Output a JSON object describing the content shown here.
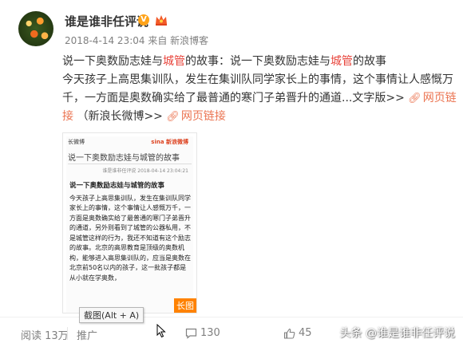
{
  "author": {
    "name": "谁是谁非任评说",
    "verified_badge": "V",
    "crown_icon": "crown-icon",
    "avatar_icon": "avatar-flowers"
  },
  "meta": {
    "timestamp": "2018-4-14 23:04",
    "source": "来自 新浪博客"
  },
  "post": {
    "title_a": "说一下奥数励志娃与",
    "title_hl1": "城管",
    "title_b": "的故事：说一下奥数励志娃与",
    "title_hl2": "城管",
    "title_c": "的故事",
    "body": "今天孩子上高思集训队，发生在集训队同学家长上的事情，这个事情让人感慨万千，一方面是奥数确实给了最普通的寒门子弟晋升的通道...文字版>>",
    "link1": "网页链接",
    "weibo_link": "（新浪长微博>>",
    "link2": "网页链接",
    "link_icon": "link-icon"
  },
  "image": {
    "head": "长微博",
    "logo": "sina 新浪微博",
    "title": "说一下奥数励志娃与城管的故事",
    "meta": "谁是谁非任评说  2018-04-14 23:04:21",
    "subtitle": "说一下奥数励志娃与城管的故事",
    "body": "今天孩子上高思集训队，发生在集训队同学家长上的事情，这个事情让人感慨万千，一方面是奥数确实给了最普通的寒门子弟晋升的通道，另外则看到了城管的公器私用，不是城管这样的行为，我还不知道有这个励志的故事。北京的高思教育是顶级的奥数机构，能够进入高思集训队的，应当是奥数在北京前50名以内的孩子，这一批孩子都是从小就在学奥数，",
    "tag": "长图"
  },
  "tooltip": "截图(Alt + A)",
  "actions": {
    "reads": "阅读 13万",
    "promote": "推广",
    "repost_count": "",
    "comment_count": "130",
    "like_count": "45"
  },
  "watermark": "头条 @谁是谁非任评说",
  "colors": {
    "highlight": "#e8443b",
    "link": "#eb7350",
    "meta": "#808080",
    "badge": "#ffa319",
    "long_tag": "#ff8200"
  }
}
